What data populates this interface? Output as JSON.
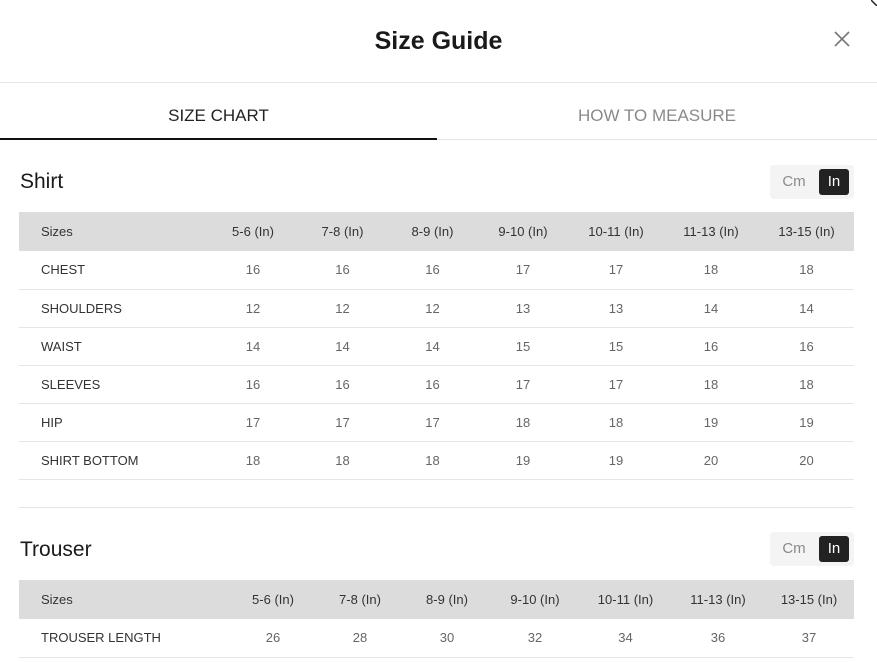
{
  "modal": {
    "title": "Size Guide"
  },
  "tabs": [
    {
      "label": "SIZE CHART",
      "active": true
    },
    {
      "label": "HOW TO MEASURE",
      "active": false
    }
  ],
  "units": {
    "cm": "Cm",
    "in": "In",
    "selected": "In"
  },
  "colors": {
    "accent": "#222222",
    "header_row": "#dcdcdc",
    "muted_text": "#8a8a8a"
  },
  "shirt": {
    "title": "Shirt",
    "columns": [
      "Sizes",
      "5-6 (In)",
      "7-8 (In)",
      "8-9 (In)",
      "9-10 (In)",
      "10-11 (In)",
      "11-13 (In)",
      "13-15 (In)"
    ],
    "rows": [
      {
        "label": "CHEST",
        "values": [
          "16",
          "16",
          "16",
          "17",
          "17",
          "18",
          "18"
        ]
      },
      {
        "label": "SHOULDERS",
        "values": [
          "12",
          "12",
          "12",
          "13",
          "13",
          "14",
          "14"
        ]
      },
      {
        "label": "WAIST",
        "values": [
          "14",
          "14",
          "14",
          "15",
          "15",
          "16",
          "16"
        ]
      },
      {
        "label": "SLEEVES",
        "values": [
          "16",
          "16",
          "16",
          "17",
          "17",
          "18",
          "18"
        ]
      },
      {
        "label": "HIP",
        "values": [
          "17",
          "17",
          "17",
          "18",
          "18",
          "19",
          "19"
        ]
      },
      {
        "label": "SHIRT BOTTOM",
        "values": [
          "18",
          "18",
          "18",
          "19",
          "19",
          "20",
          "20"
        ]
      }
    ]
  },
  "trouser": {
    "title": "Trouser",
    "columns": [
      "Sizes",
      "5-6 (In)",
      "7-8 (In)",
      "8-9 (In)",
      "9-10 (In)",
      "10-11 (In)",
      "11-13 (In)",
      "13-15 (In)"
    ],
    "rows": [
      {
        "label": "TROUSER LENGTH",
        "values": [
          "26",
          "28",
          "30",
          "32",
          "34",
          "36",
          "37"
        ]
      }
    ]
  }
}
